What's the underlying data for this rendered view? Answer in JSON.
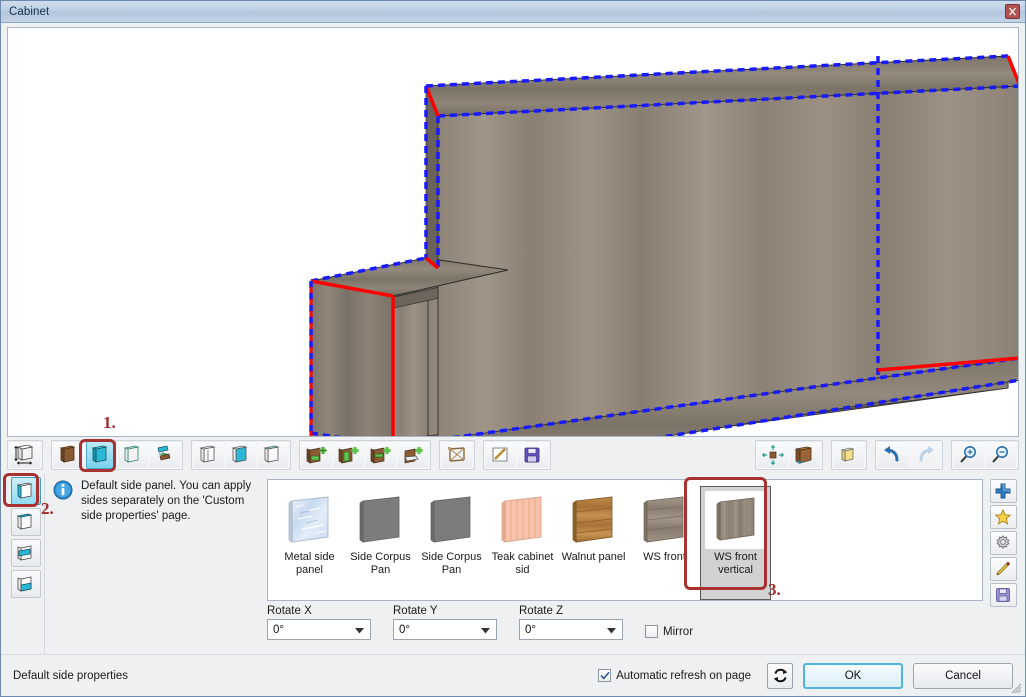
{
  "window": {
    "title": "Cabinet",
    "close_icon": "close-icon"
  },
  "toolbar": {
    "groups": [
      {
        "name": "dimensions",
        "buttons": [
          {
            "name": "cabinet-dimensions",
            "icon": "cabinet-dimensions-icon",
            "selected": false,
            "disabled": false
          }
        ]
      },
      {
        "name": "panels",
        "buttons": [
          {
            "name": "back-panel",
            "icon": "back-panel-icon",
            "selected": false,
            "disabled": false
          },
          {
            "name": "side-panel",
            "icon": "side-panel-icon",
            "selected": true,
            "disabled": false
          },
          {
            "name": "top-bottom-panel",
            "icon": "top-bottom-panel-icon",
            "selected": false,
            "disabled": false
          },
          {
            "name": "shelf-panel",
            "icon": "shelf-panel-icon",
            "selected": false,
            "disabled": false
          }
        ]
      },
      {
        "name": "corpus-types",
        "buttons": [
          {
            "name": "corpus-open",
            "icon": "corpus-open-icon",
            "selected": false,
            "disabled": false
          },
          {
            "name": "corpus-back",
            "icon": "corpus-back-icon",
            "selected": false,
            "disabled": false
          },
          {
            "name": "corpus-top",
            "icon": "corpus-top-icon",
            "selected": false,
            "disabled": false
          }
        ]
      },
      {
        "name": "add-elements",
        "buttons": [
          {
            "name": "add-drawer",
            "icon": "add-drawer-icon",
            "selected": false,
            "disabled": false
          },
          {
            "name": "add-door",
            "icon": "add-door-icon",
            "selected": false,
            "disabled": false
          },
          {
            "name": "add-shelf",
            "icon": "add-shelf-icon",
            "selected": false,
            "disabled": false
          },
          {
            "name": "add-pull-out",
            "icon": "add-pull-out-icon",
            "selected": false,
            "disabled": false
          }
        ]
      },
      {
        "name": "construction",
        "buttons": [
          {
            "name": "frame-construction",
            "icon": "frame-construction-icon",
            "selected": false,
            "disabled": false
          }
        ]
      },
      {
        "name": "file-ops",
        "buttons": [
          {
            "name": "edit-note",
            "icon": "pencil-note-icon",
            "selected": false,
            "disabled": false
          },
          {
            "name": "save-preset",
            "icon": "floppy-disk-icon",
            "selected": false,
            "disabled": false
          }
        ]
      }
    ],
    "right_groups": [
      {
        "name": "view-tools",
        "buttons": [
          {
            "name": "fit-to-view",
            "icon": "fit-arrows-icon",
            "selected": false,
            "disabled": false
          },
          {
            "name": "render-mode",
            "icon": "textured-box-icon",
            "selected": false,
            "disabled": false
          }
        ]
      },
      {
        "name": "projection",
        "buttons": [
          {
            "name": "perspective-view",
            "icon": "cube-wire-icon",
            "selected": false,
            "disabled": false
          }
        ]
      },
      {
        "name": "history",
        "buttons": [
          {
            "name": "undo-button",
            "icon": "undo-arrow-icon",
            "selected": false,
            "disabled": false
          },
          {
            "name": "redo-button",
            "icon": "redo-arrow-icon",
            "selected": false,
            "disabled": true
          }
        ]
      },
      {
        "name": "zoom",
        "buttons": [
          {
            "name": "zoom-in-button",
            "icon": "zoom-in-icon",
            "selected": false,
            "disabled": false
          },
          {
            "name": "zoom-out-button",
            "icon": "zoom-out-icon",
            "selected": false,
            "disabled": false
          }
        ]
      }
    ]
  },
  "side_tabs": [
    {
      "name": "side-panel-default",
      "icon": "side-panel-default-icon",
      "selected": true
    },
    {
      "name": "side-panel-top",
      "icon": "side-panel-top-icon",
      "selected": false
    },
    {
      "name": "side-panel-middle",
      "icon": "side-panel-middle-icon",
      "selected": false
    },
    {
      "name": "side-panel-custom",
      "icon": "side-panel-custom-icon",
      "selected": false
    }
  ],
  "info": {
    "icon": "info-icon",
    "text": "Default side panel. You can apply sides separately on the 'Custom side properties' page."
  },
  "materials": [
    {
      "name": "metal-side-panel",
      "label": "Metal side panel",
      "selected": false,
      "swatch": "metal",
      "color": "#cfdcee"
    },
    {
      "name": "side-corpus-pan-1",
      "label": "Side Corpus Pan",
      "selected": false,
      "swatch": "solid",
      "color": "#7c7c7c"
    },
    {
      "name": "side-corpus-pan-2",
      "label": "Side Corpus Pan",
      "selected": false,
      "swatch": "solid",
      "color": "#7c7c7c"
    },
    {
      "name": "teak-cabinet-sid",
      "label": "Teak cabinet sid",
      "selected": false,
      "swatch": "vertical-grain",
      "color": "#f6bfa8"
    },
    {
      "name": "walnut-panel",
      "label": "Walnut panel",
      "selected": false,
      "swatch": "horizontal-grain",
      "color": "#bd8546"
    },
    {
      "name": "ws-front",
      "label": "WS front",
      "selected": false,
      "swatch": "horizontal-grain",
      "color": "#9a8d80"
    },
    {
      "name": "ws-front-vertical",
      "label": "WS front vertical",
      "selected": true,
      "swatch": "vertical-grain",
      "color": "#9a8d80"
    }
  ],
  "right_actions": [
    {
      "name": "add-material-button",
      "icon": "plus-icon"
    },
    {
      "name": "favorite-button",
      "icon": "star-icon"
    },
    {
      "name": "settings-button",
      "icon": "gear-icon"
    },
    {
      "name": "edit-material-button",
      "icon": "pencil-icon"
    },
    {
      "name": "save-material-button",
      "icon": "floppy-icon"
    }
  ],
  "rotate": {
    "x": {
      "label": "Rotate X",
      "value": "0°"
    },
    "y": {
      "label": "Rotate Y",
      "value": "0°"
    },
    "z": {
      "label": "Rotate Z",
      "value": "0°"
    },
    "mirror": {
      "label": "Mirror",
      "checked": false
    }
  },
  "footer": {
    "status": "Default side properties",
    "auto_refresh": {
      "label": "Automatic refresh on page",
      "checked": true
    },
    "refresh_icon": "refresh-icon",
    "ok_label": "OK",
    "cancel_label": "Cancel"
  },
  "annotations": [
    {
      "name": "annotation-1",
      "label": "1."
    },
    {
      "name": "annotation-2",
      "label": "2."
    },
    {
      "name": "annotation-3",
      "label": "3."
    }
  ],
  "colors": {
    "annotation": "#a83232",
    "selection_red": "#ff0000",
    "selection_blue": "#1a1aff",
    "title_text": "#17314f",
    "accent": "#4fb4e0"
  },
  "viewport": {
    "name": "cabinet-3d-preview",
    "description": "Stepped L-shaped cabinet rendered in wood texture with red and blue dashed selection outlines on the side panels"
  }
}
